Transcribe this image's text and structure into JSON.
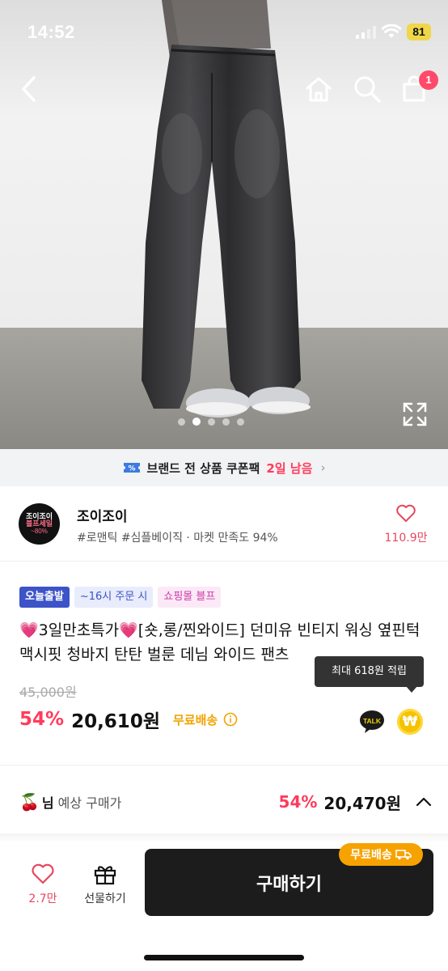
{
  "status_bar": {
    "time": "14:52",
    "battery": "81"
  },
  "header": {
    "cart_count": "1"
  },
  "gallery": {
    "total_images": 5,
    "active_index": 2
  },
  "coupon_banner": {
    "text": "브랜드 전 상품 쿠폰팩",
    "remaining": "2일 남음",
    "chevron": "›"
  },
  "store": {
    "logo_line1": "조이조이",
    "logo_line2": "블프세일",
    "logo_line3": "~80%",
    "name": "조이조이",
    "tags": "#로맨틱 #심플베이직 · 마켓 만족도 94%",
    "likes": "110.9만"
  },
  "badges": [
    "오늘출발",
    "~16시 주문 시",
    "쇼핑몰 블프"
  ],
  "product": {
    "title": "💗3일만초특가💗[숏,롱/찐와이드] 던미유 빈티지 워싱 옆핀턱 맥시핏 청바지 탄탄 벌룬 데님 와이드 팬츠",
    "original_price": "45,000원",
    "discount": "54%",
    "price": "20,610원",
    "free_shipping": "무료배송",
    "points_tooltip": "최대 618원 적립",
    "talk_label": "TALK",
    "coin_symbol": "₩"
  },
  "member_price": {
    "icon": "🍒",
    "who": "님",
    "label": "예상 구매가",
    "discount": "54%",
    "price": "20,470원"
  },
  "bottom_bar": {
    "like_count": "2.7만",
    "gift_label": "선물하기",
    "buy_label": "구매하기",
    "ship_pill": "무료배송"
  },
  "colors": {
    "accent_red": "#ff3b5c",
    "ship_orange": "#f6a200",
    "badge_blue": "#3d53c8"
  }
}
